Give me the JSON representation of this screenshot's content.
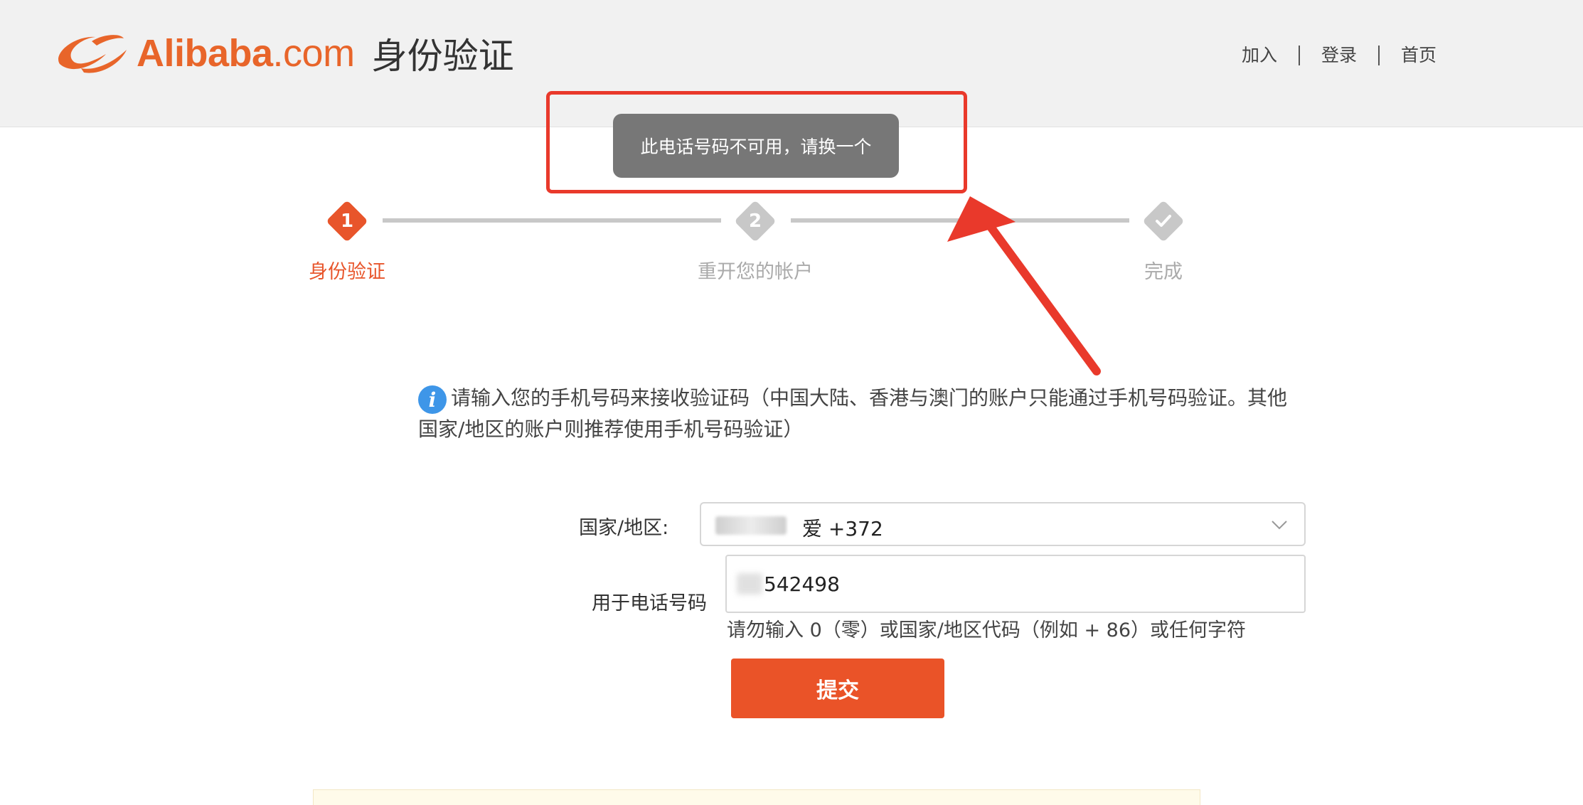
{
  "header": {
    "brand": "Alibaba",
    "brand_suffix": ".com",
    "title": "身份验证",
    "nav": [
      "加入",
      "登录",
      "首页"
    ]
  },
  "toast": {
    "message": "此电话号码不可用，请换一个"
  },
  "stepper": {
    "steps": [
      {
        "number": "1",
        "label": "身份验证",
        "state": "active"
      },
      {
        "number": "2",
        "label": "重开您的帐户",
        "state": "inactive"
      },
      {
        "number": "",
        "label": "完成",
        "state": "inactive"
      }
    ]
  },
  "info": {
    "text": "请输入您的手机号码来接收验证码（中国大陆、香港与澳门的账户只能通过手机号码验证。其他国家/地区的账户则推荐使用手机号码验证）"
  },
  "form": {
    "country_label": "国家/地区:",
    "country_value": "爱 +372",
    "phone_label": "用于电话号码",
    "phone_value": "542498",
    "hint": "请勿输入 0（零）或国家/地区代码（例如 + 86）或任何字符",
    "submit_label": "提交"
  },
  "colors": {
    "brand_orange": "#e8652a",
    "active_step": "#e8552b",
    "inactive_step": "#c8c8c8",
    "annotation_red": "#e9392b",
    "toast_bg": "#777777",
    "submit_bg": "#ea5328",
    "info_blue": "#3e96e8"
  },
  "icons": {
    "info": "info-icon",
    "checkmark": "check-icon",
    "dropdown": "chevron-down-icon"
  }
}
